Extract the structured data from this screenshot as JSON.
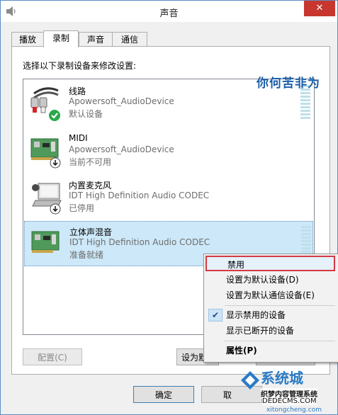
{
  "window": {
    "title": "声音",
    "close_glyph": "✕"
  },
  "tabs": [
    {
      "label": "播放",
      "active": false
    },
    {
      "label": "录制",
      "active": true
    },
    {
      "label": "声音",
      "active": false
    },
    {
      "label": "通信",
      "active": false
    }
  ],
  "panel": {
    "instruction": "选择以下录制设备来修改设置:",
    "devices": [
      {
        "name": "线路",
        "driver": "Apowersoft_AudioDevice",
        "status": "默认设备",
        "icon": "line-in-cable-icon",
        "badge": "green-check-icon"
      },
      {
        "name": "MIDI",
        "driver": "Apowersoft_AudioDevice",
        "status": "当前不可用",
        "icon": "sound-card-icon",
        "badge": "down-arrow-icon"
      },
      {
        "name": "内置麦克风",
        "driver": "IDT High Definition Audio CODEC",
        "status": "已停用",
        "icon": "laptop-microphone-icon",
        "badge": "down-arrow-icon"
      },
      {
        "name": "立体声混音",
        "driver": "IDT High Definition Audio CODEC",
        "status": "准备就绪",
        "icon": "sound-card-icon",
        "badge": ""
      }
    ]
  },
  "buttons": {
    "configure": "配置(C)",
    "set_default": "设为默",
    "ok": "确定",
    "cancel": "取"
  },
  "context_menu": {
    "items": [
      {
        "label": "禁用"
      },
      {
        "label": "设置为默认设备(D)"
      },
      {
        "label": "设置为默认通信设备(E)"
      },
      {
        "label": "显示禁用的设备"
      },
      {
        "label": "显示已断开的设备"
      },
      {
        "label": "属性(P)"
      }
    ],
    "check_glyph": "✔"
  },
  "overlay_text": "你何苦非为",
  "watermark": {
    "brand": "系统城",
    "site": "织梦内容管理系统",
    "domain": "DEDECMS.COM",
    "url": "xitongcheng.com"
  },
  "colors": {
    "accent_red": "#c7372f",
    "selection": "#cde8f8",
    "highlight_border": "#d33a44",
    "brand_blue": "#2b7bc6"
  }
}
